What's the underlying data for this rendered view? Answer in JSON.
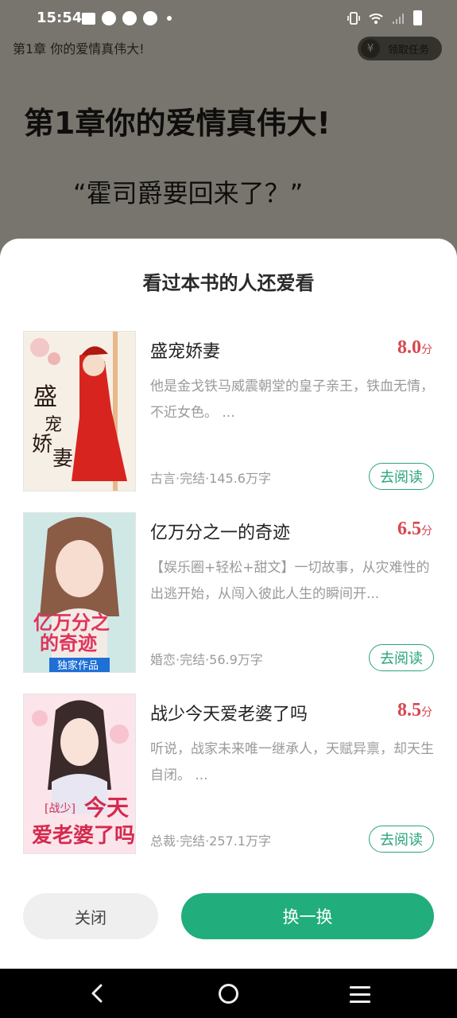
{
  "status_bar": {
    "time": "15:54"
  },
  "reader": {
    "chapter_small": "第1章  你的爱情真伟大!",
    "task_button": {
      "coin_symbol": "¥",
      "label": "领取任务"
    },
    "chapter_title": "第1章你的爱情真伟大!",
    "quote": "“霍司爵要回来了？”"
  },
  "sheet": {
    "title": "看过本书的人还爱看",
    "books": [
      {
        "name": "盛宠娇妻",
        "score": "8.0",
        "score_unit": "分",
        "description": "他是金戈铁马威震朝堂的皇子亲王，铁血无情，不近女色。 ...",
        "meta": "古言·完结·145.6万字",
        "read_label": "去阅读",
        "cover_text": "盛宠娇妻"
      },
      {
        "name": "亿万分之一的奇迹",
        "score": "6.5",
        "score_unit": "分",
        "description": "【娱乐圈+轻松+甜文】一切故事，从灾难性的出逃开始，从闯入彼此人生的瞬间开...",
        "meta": "婚恋·完结·56.9万字",
        "read_label": "去阅读",
        "cover_text": "亿万分之一的奇迹",
        "cover_badge": "独家作品"
      },
      {
        "name": "战少今天爱老婆了吗",
        "score": "8.5",
        "score_unit": "分",
        "description": "听说，战家未来唯一继承人，天赋异禀，却天生自闭。 ...",
        "meta": "总裁·完结·257.1万字",
        "read_label": "去阅读",
        "cover_text": "战少今天爱老婆了吗"
      }
    ],
    "close_label": "关闭",
    "swap_label": "换一换"
  },
  "colors": {
    "accent": "#21ad7c",
    "score": "#d7474f"
  }
}
